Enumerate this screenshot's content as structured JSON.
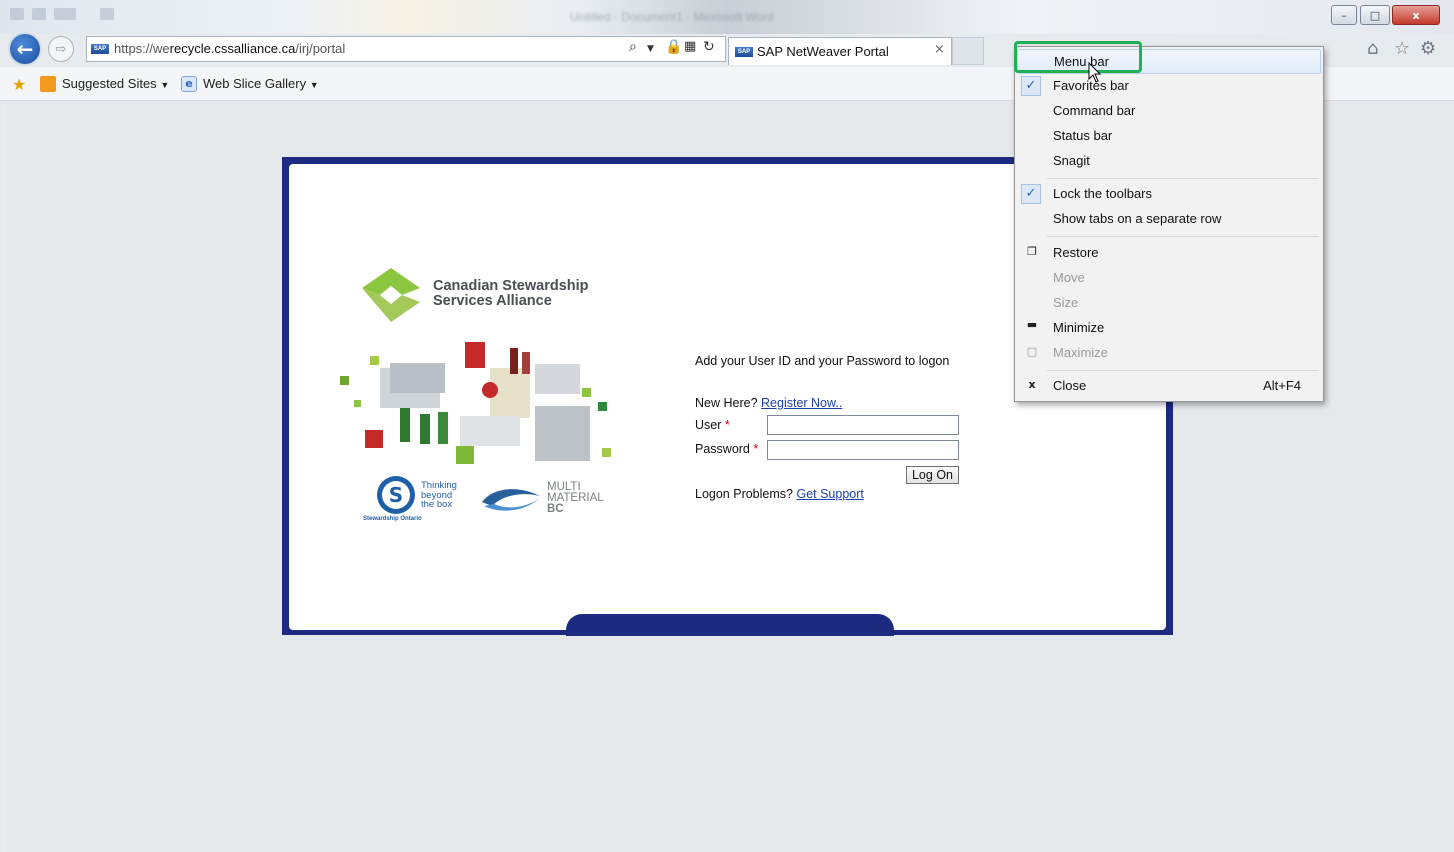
{
  "browser": {
    "address_url_prefix": "https://we",
    "address_url_domain": "recycle.cssalliance.ca",
    "address_url_suffix": "/irj/portal",
    "tab_title": "SAP NetWeaver Portal",
    "tab_close": "×",
    "sap_badge": "SAP",
    "blurred_title": "Untitled - Document1 - Microsoft Word"
  },
  "favorites_bar": {
    "suggested_sites": "Suggested Sites",
    "web_slice_gallery": "Web Slice Gallery"
  },
  "window_buttons": {
    "minimize": "–",
    "maximize": "□",
    "close": "x"
  },
  "portal": {
    "brand_line1": "Canadian Stewardship",
    "brand_line2": "Services Alliance",
    "thinking_line1": "Thinking",
    "thinking_line2": "beyond",
    "thinking_line3": "the box",
    "stewardship_ontario": "Stewardship Ontario",
    "mmbc_line1": "MULTI",
    "mmbc_line2": "MATERIAL",
    "mmbc_line3": "BC",
    "instructions": "Add your User ID and your Password to logon",
    "new_here": "New Here?",
    "register_link": "Register Now..",
    "user_label": "User",
    "password_label": "Password",
    "required_mark": "*",
    "user_value": "",
    "password_value": "",
    "logon_button": "Log On",
    "logon_problems": "Logon Problems?",
    "get_support_link": "Get Support"
  },
  "context_menu": {
    "items": [
      {
        "label": "Menu bar",
        "checked": false,
        "enabled": true
      },
      {
        "label": "Favorites bar",
        "checked": true,
        "enabled": true
      },
      {
        "label": "Command bar",
        "checked": false,
        "enabled": true
      },
      {
        "label": "Status bar",
        "checked": false,
        "enabled": true
      },
      {
        "label": "Snagit",
        "checked": false,
        "enabled": true
      },
      {
        "label": "Lock the toolbars",
        "checked": true,
        "enabled": true
      },
      {
        "label": "Show tabs on a separate row",
        "checked": false,
        "enabled": true
      },
      {
        "label": "Restore",
        "icon": "restore-icon",
        "enabled": true
      },
      {
        "label": "Move",
        "enabled": false
      },
      {
        "label": "Size",
        "enabled": false
      },
      {
        "label": "Minimize",
        "icon": "minimize-icon",
        "enabled": true
      },
      {
        "label": "Maximize",
        "icon": "maximize-icon",
        "enabled": false
      },
      {
        "label": "Close",
        "icon": "close-icon",
        "shortcut": "Alt+F4",
        "enabled": true
      }
    ],
    "check_glyph": "✓"
  },
  "colors": {
    "portal_frame": "#1c2a82",
    "highlight": "#1fb154",
    "link": "#1b3fae",
    "brand_green": "#8cc63f"
  }
}
